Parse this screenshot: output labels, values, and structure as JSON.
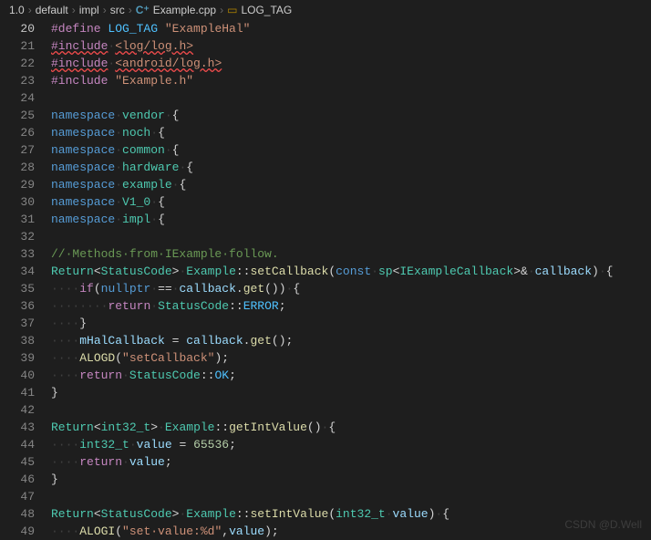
{
  "breadcrumb": {
    "parts": [
      "1.0",
      "default",
      "impl",
      "src"
    ],
    "file": "Example.cpp",
    "symbol": "LOG_TAG"
  },
  "active_line": 20,
  "lines": [
    {
      "n": 20,
      "html": "<span class='tok-macro'>#define</span> <span class='tok-const'>LOG_TAG</span> <span class='tok-string'>\"ExampleHal\"</span>"
    },
    {
      "n": 21,
      "html": "<span class='tok-macro squiggle'>#include</span><span class='tok-whitespace'>·</span><span class='tok-string squiggle'>&lt;log/log.h&gt;</span>"
    },
    {
      "n": 22,
      "html": "<span class='tok-macro squiggle'>#include</span><span class='tok-whitespace'>·</span><span class='tok-string squiggle'>&lt;android/log.h&gt;</span>"
    },
    {
      "n": 23,
      "html": "<span class='tok-macro'>#include</span> <span class='tok-string'>\"Example.h\"</span>"
    },
    {
      "n": 24,
      "html": ""
    },
    {
      "n": 25,
      "html": "<span class='tok-keyword'>namespace</span><span class='tok-whitespace'>·</span><span class='tok-ns'>vendor</span><span class='tok-whitespace'>·</span>{"
    },
    {
      "n": 26,
      "html": "<span class='tok-keyword'>namespace</span><span class='tok-whitespace'>·</span><span class='tok-ns'>noch</span><span class='tok-whitespace'>·</span>{"
    },
    {
      "n": 27,
      "html": "<span class='tok-keyword'>namespace</span><span class='tok-whitespace'>·</span><span class='tok-ns'>common</span><span class='tok-whitespace'>·</span>{"
    },
    {
      "n": 28,
      "html": "<span class='tok-keyword'>namespace</span><span class='tok-whitespace'>·</span><span class='tok-ns'>hardware</span><span class='tok-whitespace'>·</span>{"
    },
    {
      "n": 29,
      "html": "<span class='tok-keyword'>namespace</span><span class='tok-whitespace'>·</span><span class='tok-ns'>example</span><span class='tok-whitespace'>·</span>{"
    },
    {
      "n": 30,
      "html": "<span class='tok-keyword'>namespace</span><span class='tok-whitespace'>·</span><span class='tok-ns'>V1_0</span><span class='tok-whitespace'>·</span>{"
    },
    {
      "n": 31,
      "html": "<span class='tok-keyword'>namespace</span><span class='tok-whitespace'>·</span><span class='tok-ns'>impl</span><span class='tok-whitespace'>·</span>{"
    },
    {
      "n": 32,
      "html": ""
    },
    {
      "n": 33,
      "html": "<span class='tok-comment'>//·Methods·from·IExample·follow.</span>"
    },
    {
      "n": 34,
      "html": "<span class='tok-type'>Return</span>&lt;<span class='tok-type'>StatusCode</span>&gt;<span class='tok-whitespace'>·</span><span class='tok-type'>Example</span>::<span class='tok-func'>setCallback</span>(<span class='tok-keyword'>const</span><span class='tok-whitespace'>·</span><span class='tok-type'>sp</span>&lt;<span class='tok-type'>IExampleCallback</span>&gt;&amp;<span class='tok-whitespace'>·</span><span class='tok-param'>callback</span>)<span class='tok-whitespace'>·</span>{"
    },
    {
      "n": 35,
      "html": "<span class='tok-whitespace'>····</span><span class='tok-keyword2'>if</span>(<span class='tok-keyword'>nullptr</span><span class='tok-whitespace'>·</span>==<span class='tok-whitespace'>·</span><span class='tok-var'>callback</span>.<span class='tok-func'>get</span>())<span class='tok-whitespace'>·</span>{"
    },
    {
      "n": 36,
      "html": "<span class='tok-whitespace'>····</span><span class='tok-whitespace'>····</span><span class='tok-keyword2'>return</span><span class='tok-whitespace'>·</span><span class='tok-type'>StatusCode</span>::<span class='tok-const'>ERROR</span>;"
    },
    {
      "n": 37,
      "html": "<span class='tok-whitespace'>····</span>}"
    },
    {
      "n": 38,
      "html": "<span class='tok-whitespace'>····</span><span class='tok-var'>mHalCallback</span> = <span class='tok-var'>callback</span>.<span class='tok-func'>get</span>();"
    },
    {
      "n": 39,
      "html": "<span class='tok-whitespace'>····</span><span class='tok-func'>ALOGD</span>(<span class='tok-string'>\"setCallback\"</span>);"
    },
    {
      "n": 40,
      "html": "<span class='tok-whitespace'>····</span><span class='tok-keyword2'>return</span><span class='tok-whitespace'>·</span><span class='tok-type'>StatusCode</span>::<span class='tok-const'>OK</span>;"
    },
    {
      "n": 41,
      "html": "}"
    },
    {
      "n": 42,
      "html": ""
    },
    {
      "n": 43,
      "html": "<span class='tok-type'>Return</span>&lt;<span class='tok-type'>int32_t</span>&gt;<span class='tok-whitespace'>·</span><span class='tok-type'>Example</span>::<span class='tok-func'>getIntValue</span>()<span class='tok-whitespace'>·</span>{"
    },
    {
      "n": 44,
      "html": "<span class='tok-whitespace'>····</span><span class='tok-type'>int32_t</span><span class='tok-whitespace'>·</span><span class='tok-var'>value</span> = <span class='tok-number'>65536</span>;"
    },
    {
      "n": 45,
      "html": "<span class='tok-whitespace'>····</span><span class='tok-keyword2'>return</span><span class='tok-whitespace'>·</span><span class='tok-var'>value</span>;"
    },
    {
      "n": 46,
      "html": "}"
    },
    {
      "n": 47,
      "html": ""
    },
    {
      "n": 48,
      "html": "<span class='tok-type'>Return</span>&lt;<span class='tok-type'>StatusCode</span>&gt;<span class='tok-whitespace'>·</span><span class='tok-type'>Example</span>::<span class='tok-func'>setIntValue</span>(<span class='tok-type'>int32_t</span><span class='tok-whitespace'>·</span><span class='tok-param'>value</span>)<span class='tok-whitespace'>·</span>{"
    },
    {
      "n": 49,
      "html": "<span class='tok-whitespace'>····</span><span class='tok-func'>ALOGI</span>(<span class='tok-string'>\"set·value:%d\"</span>,<span class='tok-var'>value</span>);"
    }
  ],
  "watermark": "CSDN @D.Well"
}
